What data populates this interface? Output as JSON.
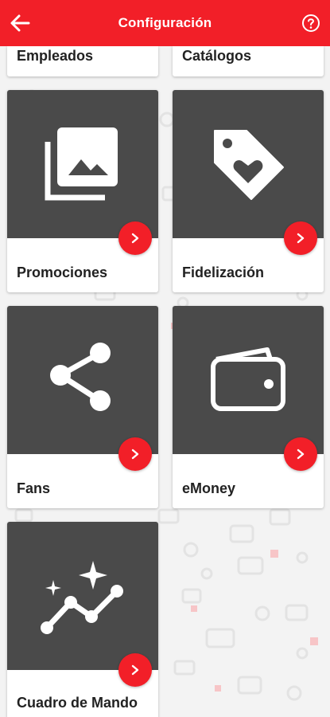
{
  "appbar": {
    "title": "Configuración",
    "back_icon": "arrow-left-icon",
    "help_icon": "help-circle-icon",
    "color": "#f21f28"
  },
  "partial_cards": [
    {
      "label": "Empleados"
    },
    {
      "label": "Catálogos"
    }
  ],
  "cards": [
    {
      "label": "Promociones",
      "icon": "image-gallery-icon"
    },
    {
      "label": "Fidelización",
      "icon": "tag-heart-icon"
    },
    {
      "label": "Fans",
      "icon": "share-icon"
    },
    {
      "label": "eMoney",
      "icon": "wallet-icon"
    },
    {
      "label": "Cuadro de Mando",
      "icon": "sparkle-chart-icon"
    }
  ],
  "theme": {
    "accent": "#f21f28",
    "tile": "#4a4a4a"
  }
}
